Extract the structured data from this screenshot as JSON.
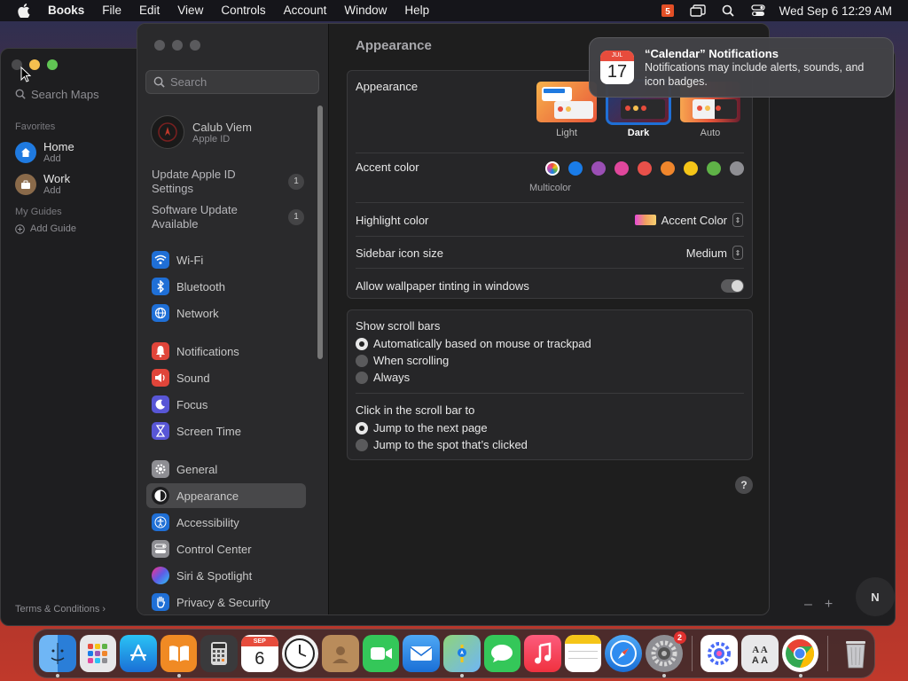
{
  "menubar": {
    "app_name": "Books",
    "items": [
      "File",
      "Edit",
      "View",
      "Controls",
      "Account",
      "Window",
      "Help"
    ],
    "datetime": "Wed Sep 6  12:29 AM"
  },
  "maps": {
    "search_placeholder": "Search Maps",
    "favorites_label": "Favorites",
    "favorites": [
      {
        "title": "Home",
        "sub": "Add"
      },
      {
        "title": "Work",
        "sub": "Add"
      }
    ],
    "guides_label": "My Guides",
    "add_guide": "Add Guide",
    "footer": "Terms & Conditions ›",
    "zoom_out": "–",
    "zoom_in": "+",
    "compass": "N"
  },
  "settings": {
    "search_placeholder": "Search",
    "account_name": "Calub Viem",
    "account_sub": "Apple ID",
    "notices": [
      {
        "label": "Update Apple ID Settings",
        "count": "1"
      },
      {
        "label": "Software Update Available",
        "count": "1"
      }
    ],
    "sidebar_items": [
      {
        "label": "Wi-Fi"
      },
      {
        "label": "Bluetooth"
      },
      {
        "label": "Network"
      },
      {
        "label": "Notifications"
      },
      {
        "label": "Sound"
      },
      {
        "label": "Focus"
      },
      {
        "label": "Screen Time"
      },
      {
        "label": "General"
      },
      {
        "label": "Appearance"
      },
      {
        "label": "Accessibility"
      },
      {
        "label": "Control Center"
      },
      {
        "label": "Siri & Spotlight"
      },
      {
        "label": "Privacy & Security"
      }
    ],
    "title": "Appearance",
    "appearance_label": "Appearance",
    "themes": [
      {
        "label": "Light"
      },
      {
        "label": "Dark"
      },
      {
        "label": "Auto"
      }
    ],
    "selected_theme": "Dark",
    "accent_label": "Accent color",
    "accent_colors": [
      "#9b59b6",
      "#1a7ce8",
      "#9b4fb5",
      "#e0479c",
      "#e8504a",
      "#f0862c",
      "#f5c518",
      "#5fb347",
      "#8e8e93"
    ],
    "multicolor_label": "Multicolor",
    "highlight_label": "Highlight color",
    "highlight_value": "Accent Color",
    "sidebar_icon_label": "Sidebar icon size",
    "sidebar_icon_value": "Medium",
    "tinting_label": "Allow wallpaper tinting in windows",
    "tinting_on": false,
    "scroll_label": "Show scroll bars",
    "scroll_options": [
      {
        "label": "Automatically based on mouse or trackpad",
        "on": true
      },
      {
        "label": "When scrolling",
        "on": false
      },
      {
        "label": "Always",
        "on": false
      }
    ],
    "click_label": "Click in the scroll bar to",
    "click_options": [
      {
        "label": "Jump to the next page",
        "on": true
      },
      {
        "label": "Jump to the spot that’s clicked",
        "on": false
      }
    ],
    "help": "?"
  },
  "notification": {
    "title": "“Calendar” Notifications",
    "body": "Notifications may include alerts, sounds, and icon badges.",
    "icon_month": "JUL",
    "icon_day": "17"
  },
  "dock": {
    "calendar_month": "SEP",
    "calendar_day": "6",
    "settings_badge": "2"
  }
}
